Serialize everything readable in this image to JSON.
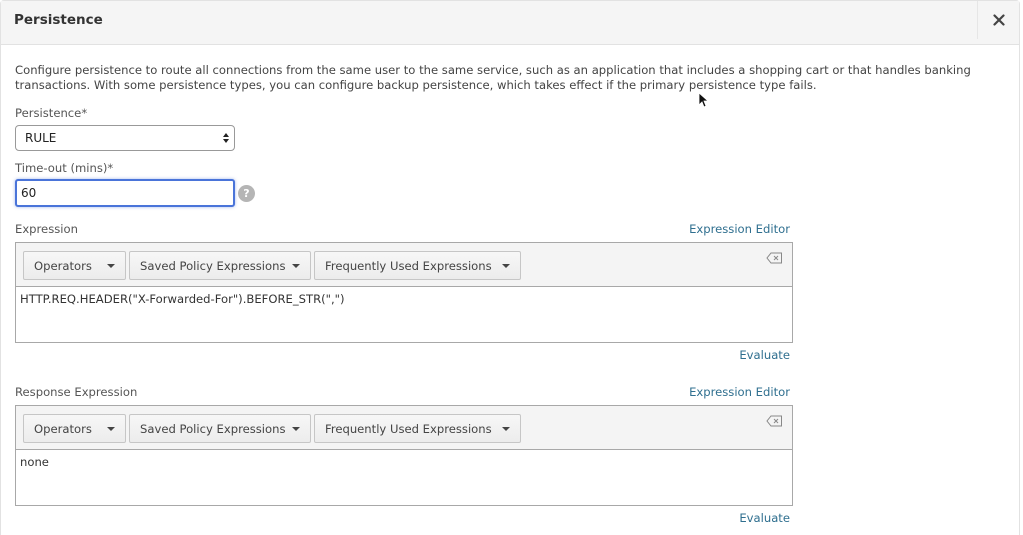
{
  "dialog": {
    "title": "Persistence",
    "close_icon": "close-icon"
  },
  "description": "Configure persistence to route all connections from the same user to the same service, such as an application that includes a shopping cart or that handles banking transactions. With some persistence types, you can configure backup persistence, which takes effect if the primary persistence type fails.",
  "persistence": {
    "label": "Persistence*",
    "value": "RULE"
  },
  "timeout": {
    "label": "Time-out (mins)*",
    "value": "60",
    "help_icon": "?"
  },
  "expression": {
    "label": "Expression",
    "editor_link": "Expression Editor",
    "operators_label": "Operators",
    "saved_label": "Saved Policy Expressions",
    "frequent_label": "Frequently Used Expressions",
    "value": "HTTP.REQ.HEADER(\"X-Forwarded-For\").BEFORE_STR(\",\")",
    "evaluate_link": "Evaluate"
  },
  "response_expression": {
    "label": "Response Expression",
    "editor_link": "Expression Editor",
    "operators_label": "Operators",
    "saved_label": "Saved Policy Expressions",
    "frequent_label": "Frequently Used Expressions",
    "value": "none",
    "evaluate_link": "Evaluate"
  },
  "colors": {
    "link": "#2f6f8f",
    "focus": "#4a74d9",
    "header_bg": "#f5f5f5"
  }
}
